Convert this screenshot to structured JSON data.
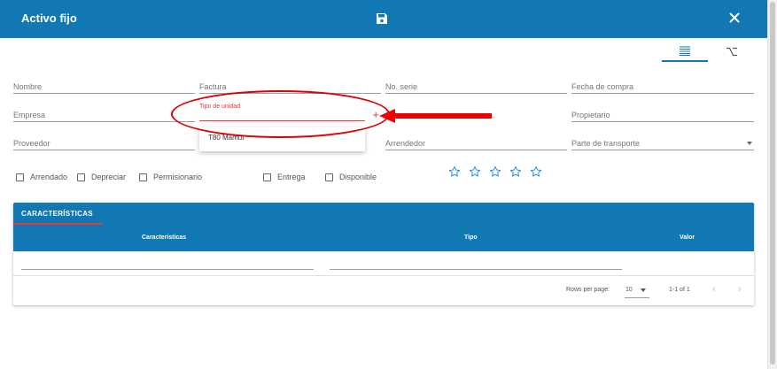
{
  "header": {
    "title": "Activo fijo",
    "save_icon": "save-icon",
    "close_icon": "close-icon",
    "color": "#1278b4"
  },
  "view_tabs": [
    {
      "icon": "list-view-icon",
      "active": true
    },
    {
      "icon": "tree-view-icon",
      "active": false
    }
  ],
  "form": {
    "nombre": "Nombre",
    "factura": "Factura",
    "no_serie": "No. serie",
    "fecha_compra": "Fecha de compra",
    "empresa": "Empresa",
    "tipo_unidad": "Tipo de unidad",
    "propietario": "Propietario",
    "proveedor": "Proveedor",
    "arrendedor": "Arrendedor",
    "parte_transporte": "Parte de transporte",
    "tipo_unidad_options": [
      "T80 Mamut"
    ]
  },
  "checkboxes": [
    "Arrendado",
    "Depreciar",
    "Permisionario",
    "Entrega",
    "Disponible"
  ],
  "rating": {
    "max": 5,
    "value": 0,
    "color": "#1278b4"
  },
  "table": {
    "tab": "CARACTERÍSTICAS",
    "columns": [
      "Caracteristicas",
      "Tipo",
      "Valor"
    ],
    "footer": {
      "rows_per_page_label": "Rows per page:",
      "rows_per_page": "10",
      "range": "1-1 of 1"
    }
  }
}
